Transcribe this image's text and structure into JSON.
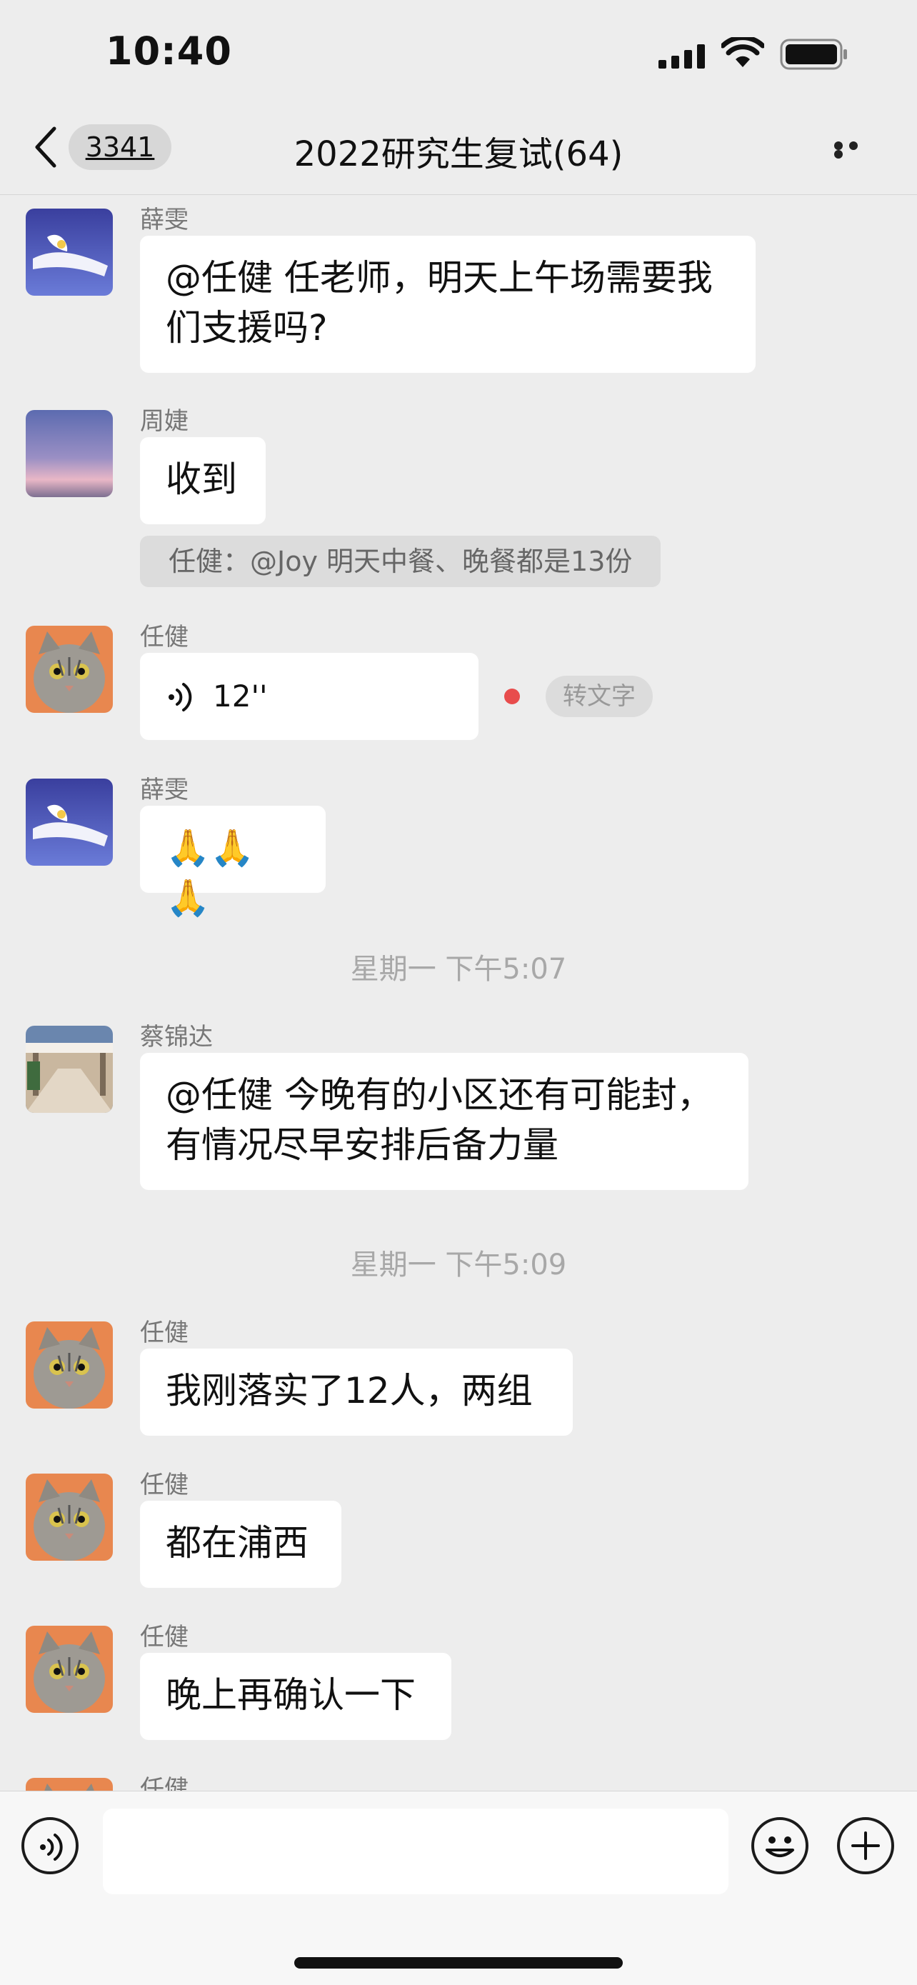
{
  "status_bar": {
    "time": "10:40"
  },
  "nav": {
    "unread_badge": "3341",
    "title": "2022研究生复试(64)"
  },
  "messages": [
    {
      "sender": "薛雯",
      "text": "@任健 任老师，明天上午场需要我\n们支援吗?"
    },
    {
      "sender": "周婕",
      "text": "收到",
      "quote": "任健：@Joy 明天中餐、晚餐都是13份"
    },
    {
      "sender": "任健",
      "voice_duration": "12''",
      "transcribe_label": "转文字"
    },
    {
      "sender": "薛雯",
      "text": "🙏🙏🙏"
    },
    {
      "sender": "蔡锦达",
      "text": "@任健 今晚有的小区还有可能封，\n有情况尽早安排后备力量"
    },
    {
      "sender": "任健",
      "text": "我刚落实了12人，两组"
    },
    {
      "sender": "任健",
      "text": "都在浦西"
    },
    {
      "sender": "任健",
      "text": "晚上再确认一下"
    },
    {
      "sender": "任健"
    }
  ],
  "timestamps": [
    "星期一 下午5:07",
    "星期一 下午5:09"
  ],
  "icons": {
    "back": "chevron-left-icon",
    "more": "more-dots-icon",
    "voice": "voice-wave-icon",
    "emoji": "emoji-icon",
    "add": "plus-circle-icon"
  }
}
